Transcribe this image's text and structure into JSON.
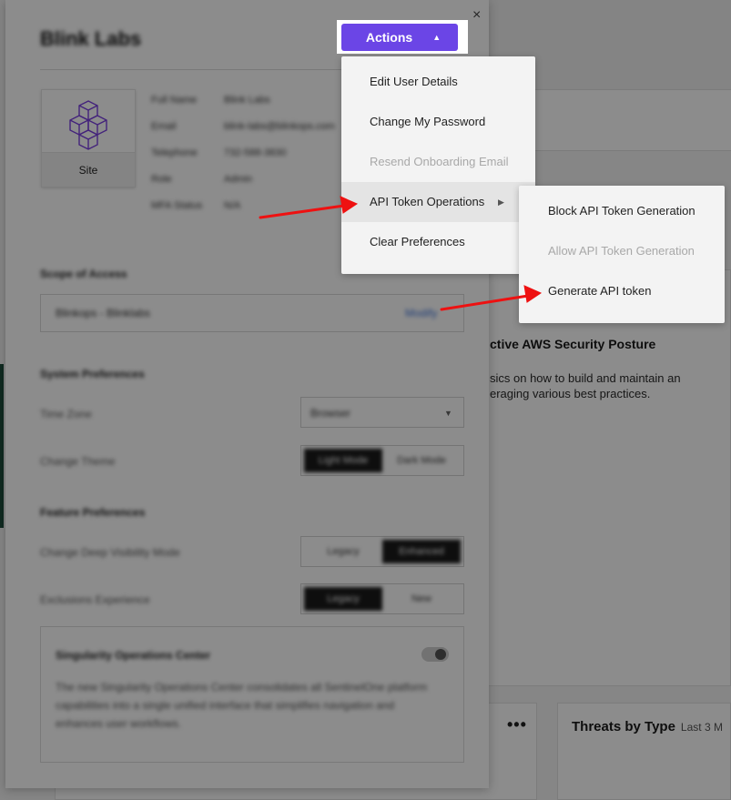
{
  "background": {
    "card_title": "ctive AWS Security Posture",
    "card_text": "sics on how to build and maintain an eraging various best practices.",
    "widget_menu": "•••",
    "widget_title": "Threats by Type",
    "widget_subtitle": "Last 3 M"
  },
  "modal": {
    "close_icon": "×",
    "title": "Blink Labs",
    "logo_label": "Site",
    "details": [
      {
        "label": "Full Name",
        "value": "Blink Labs"
      },
      {
        "label": "Email",
        "value": "blink-labs@blinkops.com"
      },
      {
        "label": "Telephone",
        "value": "732-588-3830"
      },
      {
        "label": "Role",
        "value": "Admin"
      },
      {
        "label": "MFA Status",
        "value": "N/A"
      }
    ],
    "scope_section": "Scope of Access",
    "scope_value": "Blinkops - Blinklabs",
    "scope_link": "Modify",
    "system_section": "System Preferences",
    "time_zone_label": "Time Zone",
    "time_zone_value": "Browser",
    "theme_label": "Change Theme",
    "theme_options": [
      "Light Mode",
      "Dark Mode"
    ],
    "feature_section": "Feature Preferences",
    "deep_visibility_label": "Change Deep Visibility Mode",
    "deep_visibility_options": [
      "Legacy",
      "Enhanced"
    ],
    "exclusions_label": "Exclusions Experience",
    "exclusions_options": [
      "Legacy",
      "New"
    ],
    "soc_title": "Singularity Operations Center",
    "soc_desc": "The new Singularity Operations Center consolidates all SentinelOne platform capabilities into a single unified interface that simplifies navigation and enhances user workflows."
  },
  "actions_button": {
    "label": "Actions",
    "icon": "caret-up-icon"
  },
  "menu": {
    "items": [
      {
        "label": "Edit User Details",
        "disabled": false
      },
      {
        "label": "Change My Password",
        "disabled": false
      },
      {
        "label": "Resend Onboarding Email",
        "disabled": true
      },
      {
        "label": "API Token Operations",
        "disabled": false
      },
      {
        "label": "Clear Preferences",
        "disabled": false
      }
    ],
    "submenu_icon": "caret-right-icon"
  },
  "submenu": {
    "items": [
      {
        "label": "Block API Token Generation",
        "disabled": false
      },
      {
        "label": "Allow API Token Generation",
        "disabled": true
      },
      {
        "label": "Generate API token",
        "disabled": false
      }
    ]
  },
  "colors": {
    "accent": "#6b45e6",
    "annotation_arrow": "#ee1111",
    "disabled_text": "#a8a8a8"
  }
}
